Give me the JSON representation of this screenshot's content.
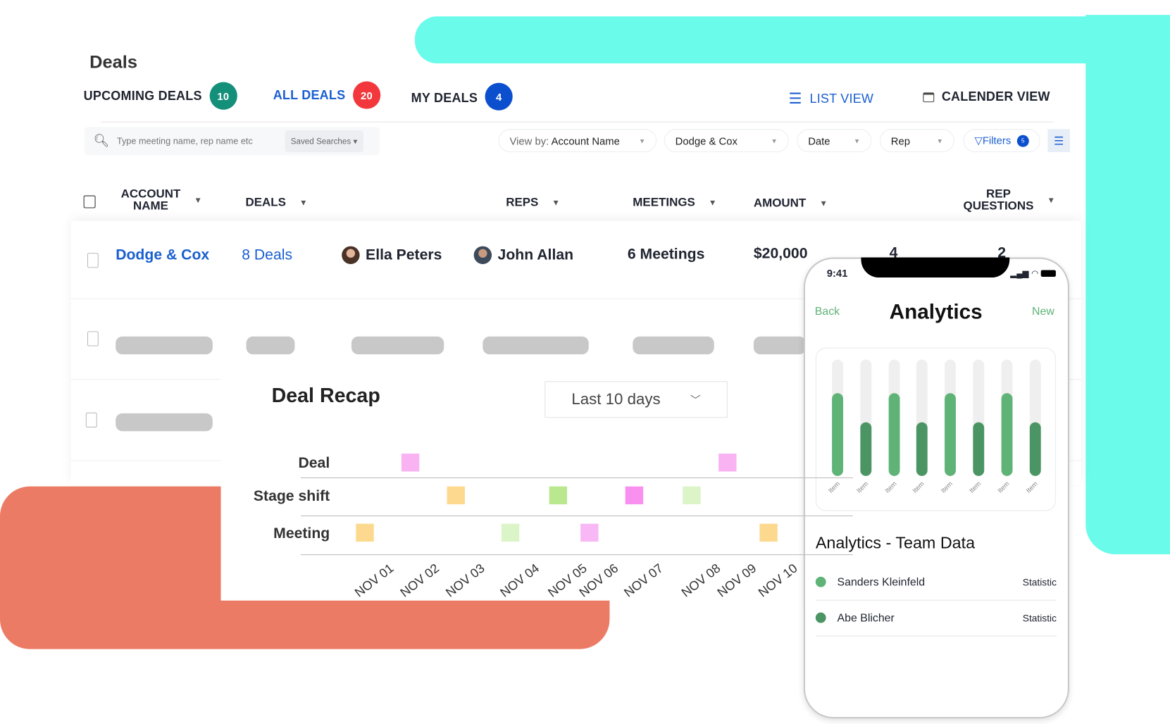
{
  "page_title": "Deals",
  "tabs": [
    {
      "label": "UPCOMING DEALS",
      "count": "10",
      "color": "#138f7a"
    },
    {
      "label": "ALL DEALS",
      "count": "20",
      "color": "#f2383d",
      "active": true
    },
    {
      "label": "MY DEALS",
      "count": "4",
      "color": "#0b4fcf"
    }
  ],
  "views": {
    "list": "LIST VIEW",
    "calendar": "CALENDER VIEW"
  },
  "search": {
    "placeholder": "Type meeting name, rep name etc",
    "saved": "Saved Searches"
  },
  "filters": {
    "view_by_label": "View by:",
    "view_by_value": "Account Name",
    "account": "Dodge  &  Cox",
    "date": "Date",
    "rep": "Rep",
    "filters": "Filters",
    "filters_count": "5"
  },
  "columns": [
    {
      "l1": "ACCOUNT",
      "l2": "NAME"
    },
    {
      "l1": "DEALS"
    },
    {
      "l1": "REPS"
    },
    {
      "l1": "MEETINGS"
    },
    {
      "l1": "AMOUNT"
    },
    {
      "l1": "REP",
      "l2": "QUESTIONS"
    }
  ],
  "row": {
    "account": "Dodge & Cox",
    "deals": "8 Deals",
    "rep1": "Ella Peters",
    "rep2": "John Allan",
    "meetings": "6 Meetings",
    "amount": "$20,000",
    "questions1": "4",
    "questions2": "2"
  },
  "recap": {
    "title": "Deal Recap",
    "range": "Last 10 days",
    "chart_data": {
      "type": "scatter",
      "categories_y": [
        "Deal",
        "Stage shift",
        "Meeting"
      ],
      "x": [
        "NOV 01",
        "NOV 02",
        "NOV 03",
        "NOV 04",
        "NOV 05",
        "NOV 06",
        "NOV 07",
        "NOV 08",
        "NOV 09",
        "NOV 10"
      ],
      "points": [
        {
          "x": "NOV 01",
          "y": "Meeting",
          "color": "#fcd98f"
        },
        {
          "x": "NOV 02",
          "y": "Deal",
          "color": "#f9b3f3"
        },
        {
          "x": "NOV 03",
          "y": "Stage shift",
          "color": "#fcd98f"
        },
        {
          "x": "NOV 04",
          "y": "Meeting",
          "color": "#dcf5c8"
        },
        {
          "x": "NOV 05",
          "y": "Stage shift",
          "color": "#b9e88e"
        },
        {
          "x": "NOV 06",
          "y": "Meeting",
          "color": "#f7b8f5"
        },
        {
          "x": "NOV 07",
          "y": "Stage shift",
          "color": "#f990ef"
        },
        {
          "x": "NOV 08",
          "y": "Stage shift",
          "color": "#dcf5c8"
        },
        {
          "x": "NOV 09",
          "y": "Deal",
          "color": "#f9b3f3"
        },
        {
          "x": "NOV 10",
          "y": "Meeting",
          "color": "#fcd98f"
        }
      ]
    }
  },
  "phone": {
    "time": "9:41",
    "back": "Back",
    "title": "Analytics",
    "new": "New",
    "chart_data": {
      "type": "bar",
      "categories": [
        "Item",
        "Item",
        "Item",
        "Item",
        "Item",
        "Item",
        "Item",
        "Item"
      ],
      "values": [
        0.71,
        0.46,
        0.71,
        0.46,
        0.71,
        0.46,
        0.71,
        0.46
      ],
      "ylim": [
        0,
        1
      ],
      "colors": [
        "#5fb377",
        "#4a9563"
      ]
    },
    "section_title": "Analytics - Team Data",
    "list": [
      {
        "name": "Sanders Kleinfeld",
        "value": "Statistic",
        "color": "#5fb377"
      },
      {
        "name": "Abe Blicher",
        "value": "Statistic",
        "color": "#4a9563"
      }
    ],
    "accent": "#5fb377"
  },
  "colors": {
    "cyan": "#6bfbeb",
    "salmon": "#ec7b65",
    "link": "#1a5fd0"
  }
}
